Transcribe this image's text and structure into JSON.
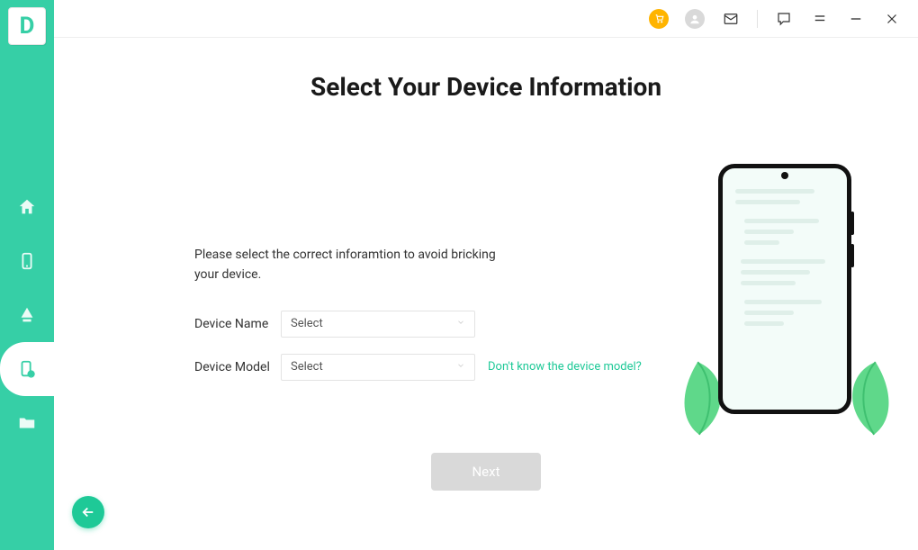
{
  "app": {
    "logo_letter": "D"
  },
  "page": {
    "title": "Select Your Device Information",
    "instruction": "Please select the correct inforamtion to avoid bricking your device.",
    "next_button": "Next"
  },
  "form": {
    "device_name": {
      "label": "Device Name",
      "value": "Select"
    },
    "device_model": {
      "label": "Device Model",
      "value": "Select",
      "help_link": "Don't know the device model?"
    }
  },
  "sidebar": {
    "items": [
      {
        "id": "home"
      },
      {
        "id": "phone"
      },
      {
        "id": "cloud"
      },
      {
        "id": "recover",
        "active": true
      },
      {
        "id": "folder"
      }
    ]
  },
  "titlebar": {
    "icons": [
      "cart",
      "profile",
      "mail",
      "feedback",
      "menu",
      "minimize",
      "close"
    ]
  }
}
